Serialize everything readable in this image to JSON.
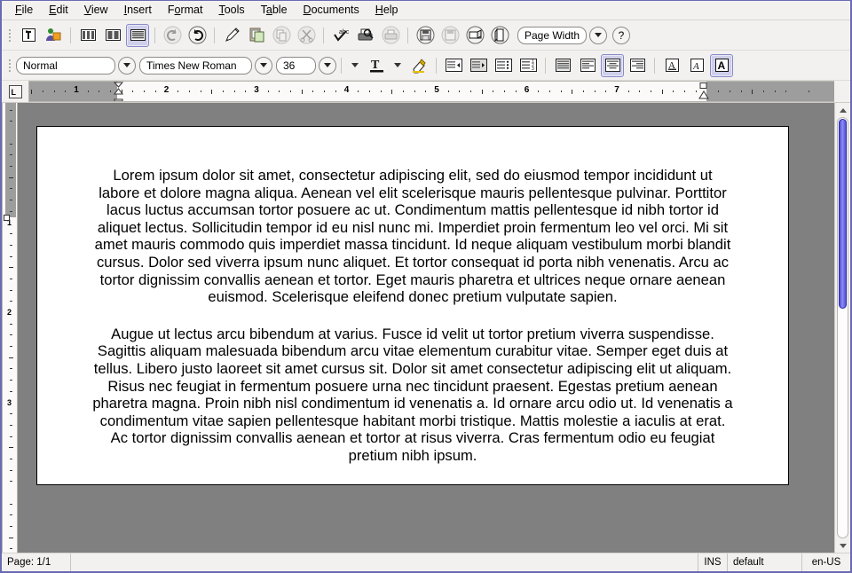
{
  "menubar": {
    "items": [
      {
        "label": "File",
        "mnemonic": "F"
      },
      {
        "label": "Edit",
        "mnemonic": "E"
      },
      {
        "label": "View",
        "mnemonic": "V"
      },
      {
        "label": "Insert",
        "mnemonic": "I"
      },
      {
        "label": "Format",
        "mnemonic": "o"
      },
      {
        "label": "Tools",
        "mnemonic": "T"
      },
      {
        "label": "Table",
        "mnemonic": "a"
      },
      {
        "label": "Documents",
        "mnemonic": "D"
      },
      {
        "label": "Help",
        "mnemonic": "H"
      }
    ]
  },
  "toolbar": {
    "zoom_value": "Page Width",
    "help_label": "?",
    "buttons": [
      {
        "name": "text-cursor-tool",
        "label": "Text Cursor"
      },
      {
        "name": "person-object-tool",
        "label": "Insert Object"
      },
      {
        "name": "view-columns-grid",
        "label": "Grid View"
      },
      {
        "name": "view-two-columns",
        "label": "Two Column View"
      },
      {
        "name": "view-full-lines",
        "label": "Full Lines View",
        "active": true
      },
      {
        "name": "undo",
        "label": "Undo",
        "disabled": true
      },
      {
        "name": "redo",
        "label": "Redo"
      },
      {
        "name": "pen-tool",
        "label": "Pen"
      },
      {
        "name": "clipboard-paste",
        "label": "Paste"
      },
      {
        "name": "copy",
        "label": "Copy",
        "disabled": true
      },
      {
        "name": "cut",
        "label": "Cut",
        "disabled": true
      },
      {
        "name": "spellcheck",
        "label": "Spelling"
      },
      {
        "name": "print-preview",
        "label": "Print Preview"
      },
      {
        "name": "print",
        "label": "Print",
        "disabled": true
      },
      {
        "name": "save",
        "label": "Save"
      },
      {
        "name": "save-as",
        "label": "Save As",
        "disabled": true
      },
      {
        "name": "page-landscape",
        "label": "Landscape"
      },
      {
        "name": "page-portrait",
        "label": "Portrait"
      }
    ]
  },
  "formatbar": {
    "style_value": "Normal",
    "font_value": "Times New Roman",
    "size_value": "36",
    "buttons": [
      {
        "name": "font-color",
        "label": "Font Color"
      },
      {
        "name": "highlight-color",
        "label": "Highlighting"
      },
      {
        "name": "decrease-indent",
        "label": "Decrease Indent"
      },
      {
        "name": "increase-indent",
        "label": "Increase Indent"
      },
      {
        "name": "bullet-list",
        "label": "Bulleted List"
      },
      {
        "name": "numbered-list",
        "label": "Numbered List"
      },
      {
        "name": "align-justify",
        "label": "Justified"
      },
      {
        "name": "align-left",
        "label": "Align Left"
      },
      {
        "name": "align-center",
        "label": "Align Center",
        "active": true
      },
      {
        "name": "align-right",
        "label": "Align Right"
      },
      {
        "name": "underline",
        "label": "Underline"
      },
      {
        "name": "italic",
        "label": "Italic"
      },
      {
        "name": "bold",
        "label": "Bold",
        "active": true
      }
    ]
  },
  "ruler": {
    "horizontal_numbers": [
      "1",
      "2",
      "3",
      "4",
      "5",
      "6",
      "7"
    ],
    "vertical_numbers": [
      "1",
      "2",
      "3"
    ],
    "tab_selector": "L"
  },
  "document": {
    "paragraphs": [
      "Lorem ipsum dolor sit amet, consectetur adipiscing elit, sed do eiusmod tempor incididunt ut labore et dolore magna aliqua. Aenean vel elit scelerisque mauris pellentesque pulvinar. Porttitor lacus luctus accumsan tortor posuere ac ut. Condimentum mattis pellentesque id nibh tortor id aliquet lectus. Sollicitudin tempor id eu nisl nunc mi. Imperdiet proin fermentum leo vel orci. Mi sit amet mauris commodo quis imperdiet massa tincidunt. Id neque aliquam vestibulum morbi blandit cursus. Dolor sed viverra ipsum nunc aliquet. Et tortor consequat id porta nibh venenatis. Arcu ac tortor dignissim convallis aenean et tortor. Eget mauris pharetra et ultrices neque ornare aenean euismod. Scelerisque eleifend donec pretium vulputate sapien.",
      "Augue ut lectus arcu bibendum at varius. Fusce id velit ut tortor pretium viverra suspendisse. Sagittis aliquam malesuada bibendum arcu vitae elementum curabitur vitae. Semper eget duis at tellus. Libero justo laoreet sit amet cursus sit. Dolor sit amet consectetur adipiscing elit ut aliquam. Risus nec feugiat in fermentum posuere urna nec tincidunt praesent. Egestas pretium aenean pharetra magna. Proin nibh nisl condimentum id venenatis a. Id ornare arcu odio ut. Id venenatis a condimentum vitae sapien pellentesque habitant morbi tristique. Mattis molestie a iaculis at erat. Ac tortor dignissim convallis aenean et tortor at risus viverra. Cras fermentum odio eu feugiat pretium nibh ipsum."
    ]
  },
  "statusbar": {
    "page": "Page: 1/1",
    "insert_mode": "INS",
    "style": "default",
    "language": "en-US"
  },
  "colors": {
    "accent": "#6a6ab4",
    "active_button": "#cfcfeb",
    "workspace": "#808080",
    "scrollbar_thumb": "#4b4bd8"
  }
}
